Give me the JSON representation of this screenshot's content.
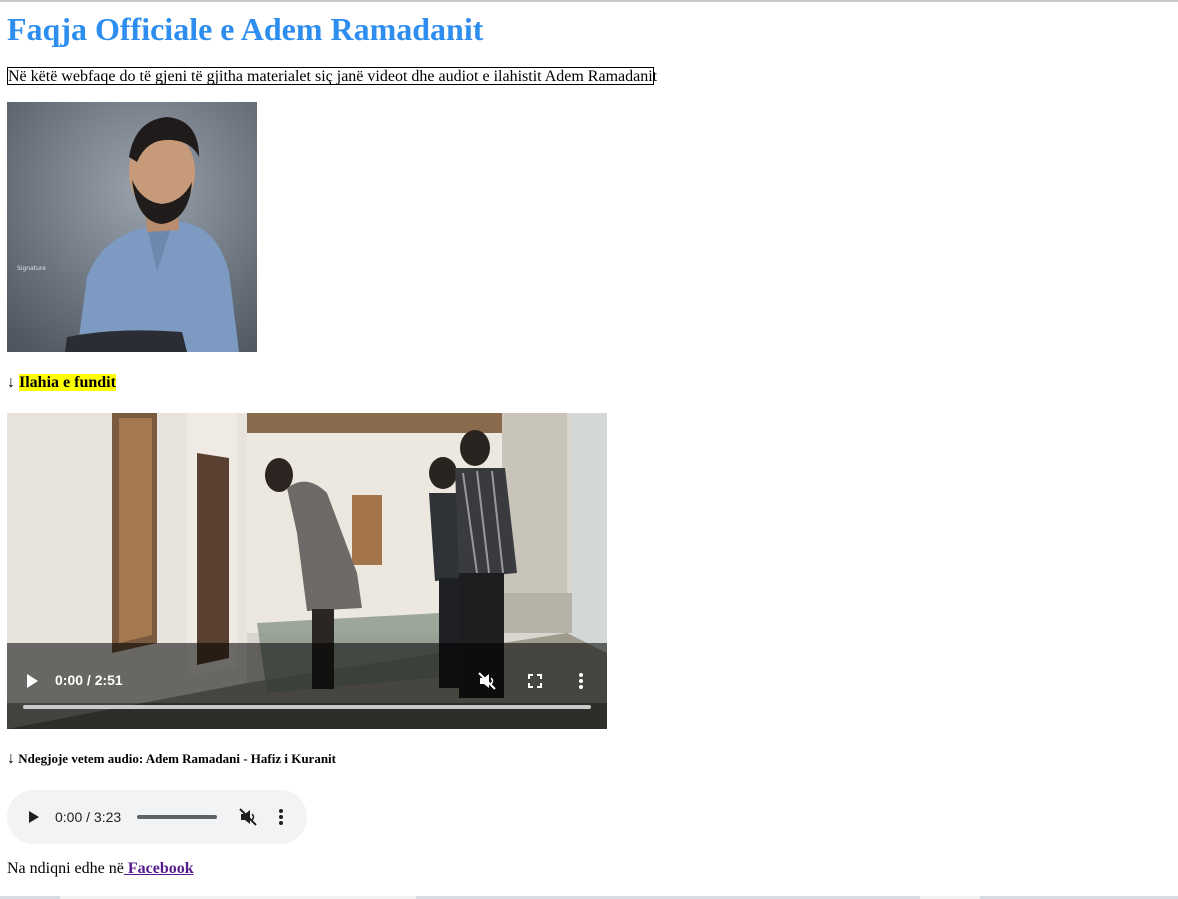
{
  "page": {
    "heading": "Faqja Officiale e Adem Ramadanit",
    "intro": "Në këtë webfaqe do të gjeni të gjitha materialet siç janë videot dhe audiot e ilahistit Adem Ramadanit"
  },
  "latest": {
    "arrow": "↓",
    "label": "Ilahia e fundit"
  },
  "video": {
    "time": "0:00 / 2:51",
    "progress": 0
  },
  "audio_section": {
    "arrow": "↓",
    "label": "Ndegjoje vetem audio: Adem Ramadani - Hafiz i Kuranit"
  },
  "audio": {
    "time": "0:00 / 3:23",
    "progress": 0
  },
  "footer": {
    "text": "Na ndiqni edhe në",
    "link_label": " Facebook"
  },
  "icons": [
    "play-icon",
    "muted-speaker-icon",
    "fullscreen-icon",
    "more-options-icon"
  ],
  "colors": {
    "heading": "#2d8ef0",
    "highlight": "#ffff00",
    "link": "#551a8b",
    "audio_bg": "#f1f3f4"
  }
}
